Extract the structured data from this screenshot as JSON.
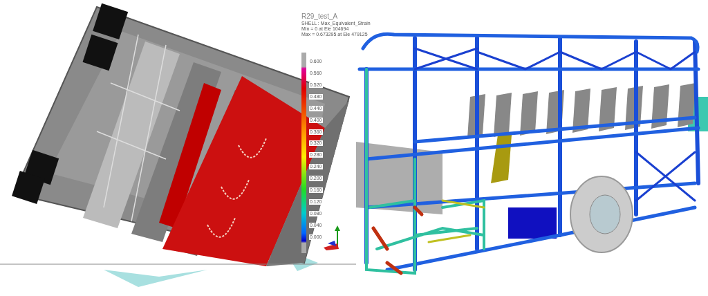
{
  "crash_view": {
    "title": "R29_test_A",
    "info_lines": [
      "SHELL : Max_Equivalent_Strain",
      "Min = 0 at Ele 104694",
      "Max = 0.673295 at Ele 479125"
    ],
    "legend_labels": [
      "0.600",
      "0.560",
      "0.520",
      "0.480",
      "0.440",
      "0.400",
      "0.360",
      "0.320",
      "0.280",
      "0.240",
      "0.200",
      "0.160",
      "0.120",
      "0.080",
      "0.040",
      "0.000"
    ]
  }
}
